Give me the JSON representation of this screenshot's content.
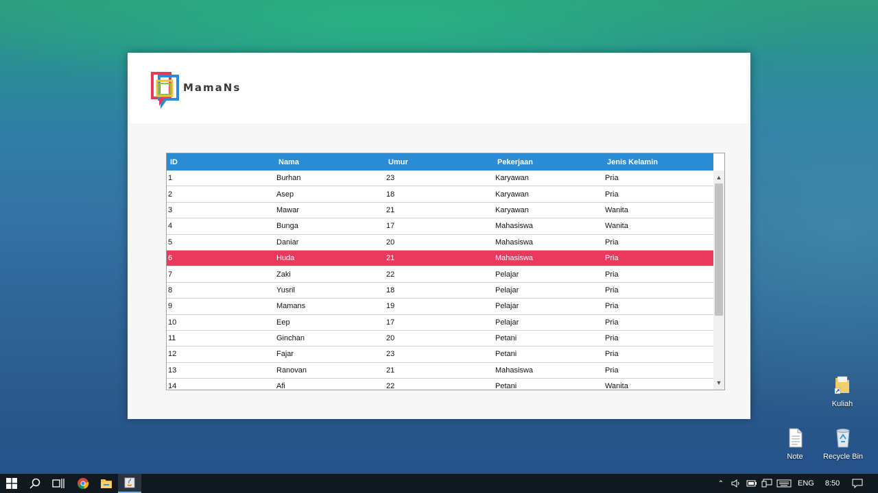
{
  "brand": {
    "name": "MamaNs"
  },
  "table": {
    "columns": [
      "ID",
      "Nama",
      "Umur",
      "Pekerjaan",
      "Jenis Kelamin"
    ],
    "selected_index": 5,
    "rows": [
      [
        "1",
        "Burhan",
        "23",
        "Karyawan",
        "Pria"
      ],
      [
        "2",
        "Asep",
        "18",
        "Karyawan",
        "Pria"
      ],
      [
        "3",
        "Mawar",
        "21",
        "Karyawan",
        "Wanita"
      ],
      [
        "4",
        "Bunga",
        "17",
        "Mahasiswa",
        "Wanita"
      ],
      [
        "5",
        "Daniar",
        "20",
        "Mahasiswa",
        "Pria"
      ],
      [
        "6",
        "Huda",
        "21",
        "Mahasiswa",
        "Pria"
      ],
      [
        "7",
        "Zaki",
        "22",
        "Pelajar",
        "Pria"
      ],
      [
        "8",
        "Yusril",
        "18",
        "Pelajar",
        "Pria"
      ],
      [
        "9",
        "Mamans",
        "19",
        "Pelajar",
        "Pria"
      ],
      [
        "10",
        "Eep",
        "17",
        "Pelajar",
        "Pria"
      ],
      [
        "11",
        "Ginchan",
        "20",
        "Petani",
        "Pria"
      ],
      [
        "12",
        "Fajar",
        "23",
        "Petani",
        "Pria"
      ],
      [
        "13",
        "Ranovan",
        "21",
        "Mahasiswa",
        "Pria"
      ],
      [
        "14",
        "Afi",
        "22",
        "Petani",
        "Wanita"
      ]
    ]
  },
  "desktop": {
    "icons": [
      {
        "label": "Kuliah",
        "icon": "folder-shortcut-icon"
      },
      {
        "label": "Note",
        "icon": "text-file-icon"
      },
      {
        "label": "Recycle Bin",
        "icon": "recycle-bin-icon"
      }
    ]
  },
  "taskbar": {
    "language": "ENG",
    "time": "8:50"
  },
  "colors": {
    "header_bg": "#2a8cd4",
    "selected_row": "#e93a5e",
    "logo_red": "#e23a5a",
    "logo_blue": "#2a8cd4",
    "logo_yellow": "#f2c230",
    "logo_green": "#8cc63f"
  }
}
